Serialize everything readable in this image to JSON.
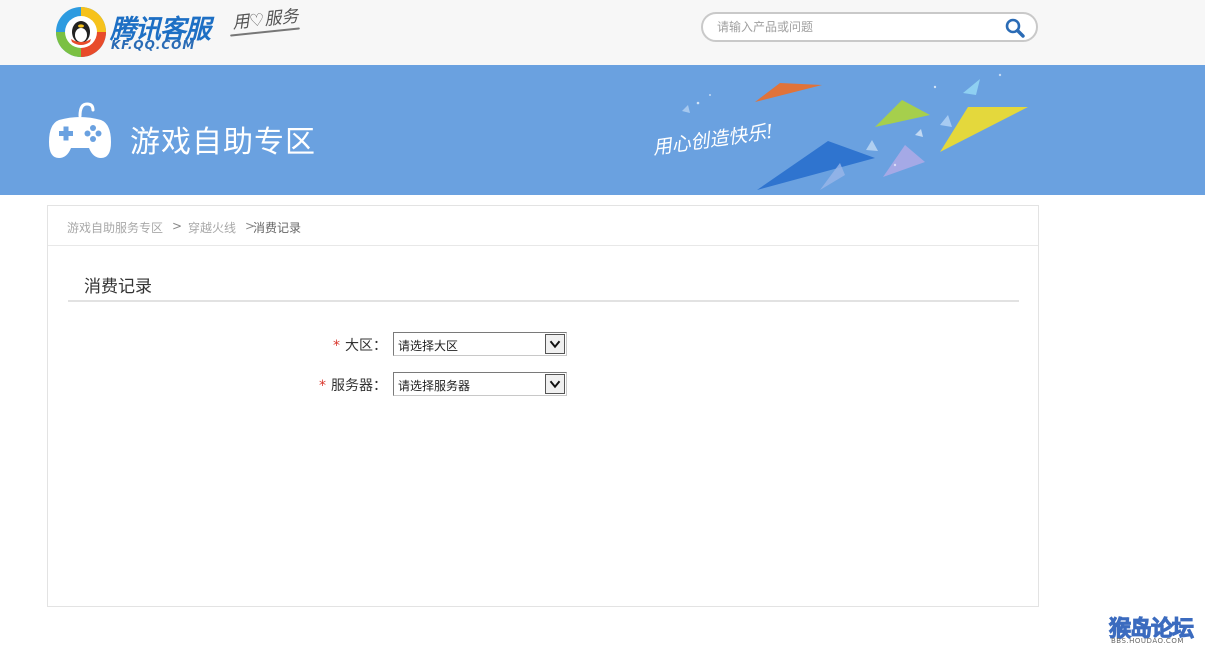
{
  "header": {
    "logo_title": "腾讯客服",
    "logo_sub": "KF.QQ.COM",
    "logo_slogan": "用♡服务",
    "search_placeholder": "请输入产品或问题",
    "search_icon": "magnifier-icon"
  },
  "banner": {
    "title": "游戏自助专区",
    "script": "用心创造快乐!",
    "icon": "gamepad-icon",
    "colors": {
      "background": "#6aa1e0",
      "orange": "#e0733a",
      "green": "#a6cf4c",
      "yellow": "#e4d83c",
      "blue": "#2f74cf",
      "lavender": "#a5a9e6"
    }
  },
  "breadcrumb": {
    "items": [
      "游戏自助服务专区",
      "穿越火线",
      "消费记录"
    ],
    "separator": ">"
  },
  "section": {
    "title": "消费记录"
  },
  "form": {
    "required_mark": "*",
    "fields": [
      {
        "label": "大区：",
        "value": "请选择大区"
      },
      {
        "label": "服务器：",
        "value": "请选择服务器"
      }
    ]
  },
  "watermark": {
    "text": "猴岛论坛",
    "sub": "BBS.HOUDAO.COM"
  },
  "colors": {
    "required": "#d9352b",
    "brand_blue": "#1d6fc4"
  }
}
